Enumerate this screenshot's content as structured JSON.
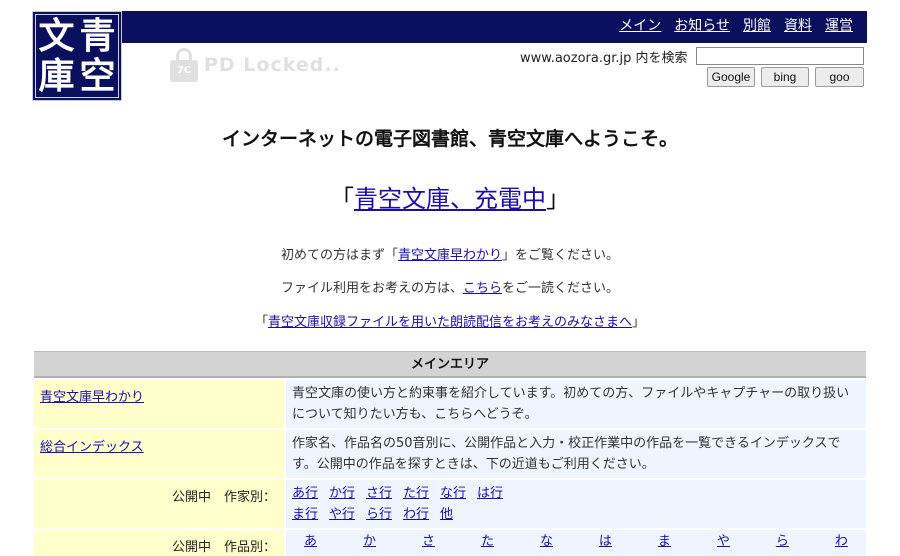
{
  "logo": {
    "chars": [
      "文",
      "青",
      "庫",
      "空"
    ]
  },
  "nav": [
    {
      "label": "メイン"
    },
    {
      "label": "お知らせ"
    },
    {
      "label": "別館"
    },
    {
      "label": "資料"
    },
    {
      "label": "運営"
    }
  ],
  "watermark": {
    "text": "PD Locked..",
    "badge": "7C"
  },
  "search": {
    "label": "www.aozora.gr.jp 内を検索",
    "value": "",
    "buttons": [
      "Google",
      "bing",
      "goo"
    ]
  },
  "welcome": "インターネットの電子図書館、青空文庫へようこそ。",
  "headline": {
    "open": "「",
    "link": "青空文庫、充電中",
    "close": "」"
  },
  "intro": {
    "line1": {
      "pre": "初めての方はまず「",
      "link": "青空文庫早わかり",
      "post": "」をご覧ください。"
    },
    "line2": {
      "pre": "ファイル利用をお考えの方は、",
      "link": "こちら",
      "post": "をご一読ください。"
    },
    "line3": {
      "pre": "「",
      "link": "青空文庫収録ファイルを用いた朗読配信をお考えのみなさまへ",
      "post": "」"
    }
  },
  "main_area": {
    "title": "メインエリア",
    "rows": [
      {
        "link": "青空文庫早わかり",
        "desc": "青空文庫の使い方と約束事を紹介しています。初めての方、ファイルやキャプチャーの取り扱いについて知りたい方も、こちらへどうぞ。"
      },
      {
        "link": "総合インデックス",
        "desc": "作家名、作品名の50音別に、公開作品と入力・校正作業中の作品を一覧できるインデックスです。公開中の作品を探すときは、下の近道もご利用ください。"
      }
    ],
    "author_index": {
      "label": "公開中　作家別：",
      "items": [
        "あ行",
        "か行",
        "さ行",
        "た行",
        "な行",
        "は行",
        "ま行",
        "や行",
        "ら行",
        "わ行",
        "他"
      ]
    },
    "title_index": {
      "label": "公開中　作品別：",
      "items": [
        "あ",
        "か",
        "さ",
        "た",
        "な",
        "は",
        "ま",
        "や",
        "ら",
        "わ"
      ]
    }
  }
}
